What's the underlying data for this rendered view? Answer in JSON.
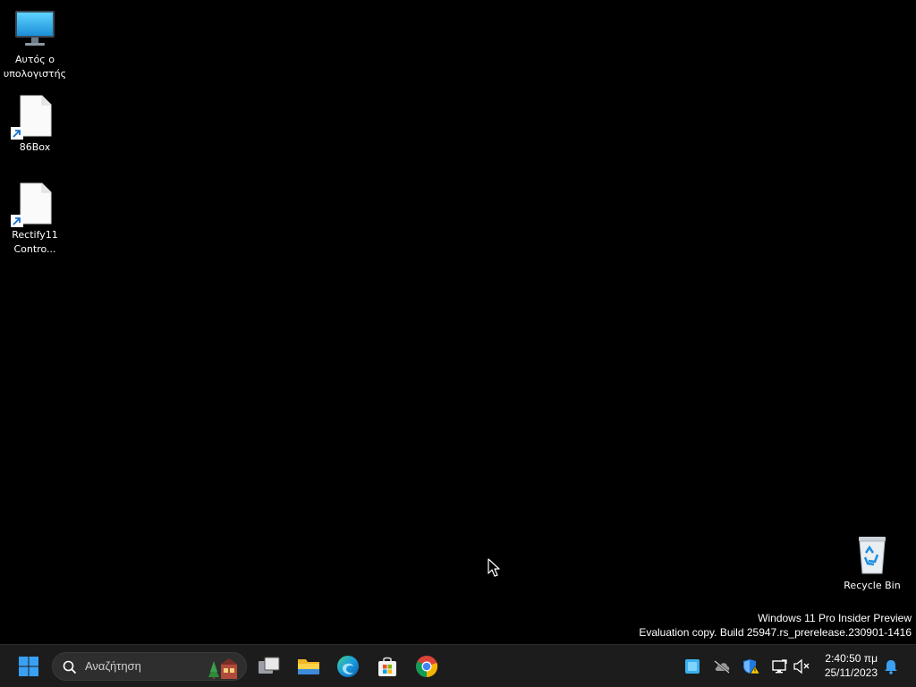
{
  "desktop": {
    "icons": [
      {
        "label": "Αυτός ο υπολογιστής",
        "icon": "monitor-icon"
      },
      {
        "label": "86Box",
        "icon": "shortcut-file-icon"
      },
      {
        "label": "Rectify11 Contro...",
        "icon": "shortcut-file-icon"
      },
      {
        "label": "Recycle Bin",
        "icon": "recycle-bin-icon"
      }
    ],
    "watermark": {
      "line1": "Windows 11 Pro Insider Preview",
      "line2": "Evaluation copy. Build 25947.rs_prerelease.230901-1416"
    }
  },
  "taskbar": {
    "search": {
      "placeholder": "Αναζήτηση"
    },
    "pinned": [
      "task-view-icon",
      "file-explorer-icon",
      "edge-icon",
      "store-icon",
      "chrome-icon"
    ],
    "tray": [
      "app-tray-icon",
      "onedrive-icon",
      "defender-icon",
      "network-icon",
      "volume-muted-icon"
    ],
    "clock": {
      "time": "2:40:50 πμ",
      "date": "25/11/2023"
    },
    "notifications_icon": "bell-icon"
  }
}
